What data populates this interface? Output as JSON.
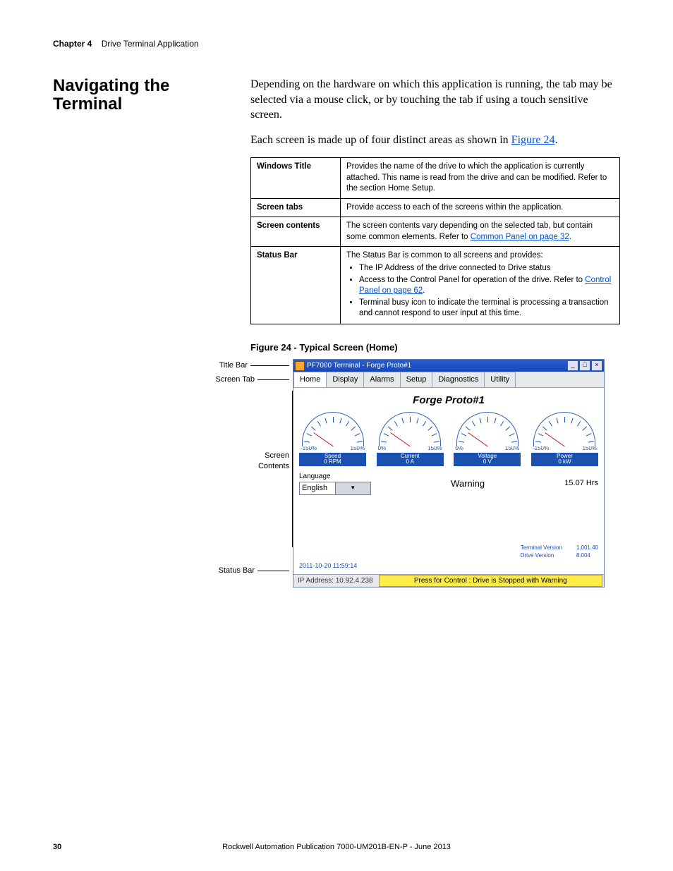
{
  "header": {
    "chapter": "Chapter 4",
    "title": "Drive Terminal Application"
  },
  "section_heading": "Navigating the Terminal",
  "para1": "Depending on the hardware on which this application is running, the tab may be selected via a mouse click, or by touching the tab if using a touch sensitive screen.",
  "para2_a": "Each screen is made up of four distinct areas as shown in ",
  "para2_link": "Figure 24",
  "table": {
    "r1": {
      "label": "Windows Title",
      "text": "Provides the name of the drive to which the application is currently attached. This name is read from the drive and can be modified. Refer to the section Home Setup."
    },
    "r2": {
      "label": "Screen tabs",
      "text": "Provide access to each of the screens within the application."
    },
    "r3": {
      "label": "Screen contents",
      "text_a": "The screen contents vary depending on the selected tab, but contain some common elements. Refer to ",
      "link": "Common Panel on page 32",
      "text_b": "."
    },
    "r4": {
      "label": "Status Bar",
      "intro": "The Status Bar is common to all screens and provides:",
      "b1": "The IP Address of the drive connected to Drive status",
      "b2_a": "Access to the Control Panel for operation of the drive. Refer to ",
      "b2_link": "Control Panel on page 62",
      "b2_b": ".",
      "b3": "Terminal busy icon to indicate the terminal is processing a transaction and cannot respond to user input at this time."
    }
  },
  "figure_caption": "Figure 24 - Typical Screen (Home)",
  "callouts": {
    "titlebar": "Title Bar",
    "screentab": "Screen Tab",
    "contents_a": "Screen",
    "contents_b": "Contents",
    "statusbar": "Status Bar"
  },
  "window": {
    "title": "PF7000 Terminal - Forge Proto#1",
    "tabs": [
      "Home",
      "Display",
      "Alarms",
      "Setup",
      "Diagnostics",
      "Utility"
    ],
    "drive_name": "Forge Proto#1",
    "gauges": [
      {
        "left": "-150%",
        "right": "150%",
        "name": "Speed",
        "val": "0 RPM"
      },
      {
        "left": "0%",
        "right": "150%",
        "name": "Current",
        "val": "0 A"
      },
      {
        "left": "0%",
        "right": "150%",
        "name": "Voltage",
        "val": "0 V"
      },
      {
        "left": "-150%",
        "right": "150%",
        "name": "Power",
        "val": "0 kW"
      }
    ],
    "lang_label": "Language",
    "lang_value": "English",
    "warning": "Warning",
    "hours": "15.07  Hrs",
    "term_ver_label": "Terminal Version",
    "term_ver": "1.001.40",
    "drive_ver_label": "Drive Version",
    "drive_ver": "8.004",
    "timestamp": "2011-10-20 11:59:14",
    "ip": "IP Address: 10.92.4.238",
    "control_msg": "Press for Control : Drive is Stopped with Warning"
  },
  "footer": {
    "page": "30",
    "pub": "Rockwell Automation Publication 7000-UM201B-EN-P - June 2013"
  }
}
